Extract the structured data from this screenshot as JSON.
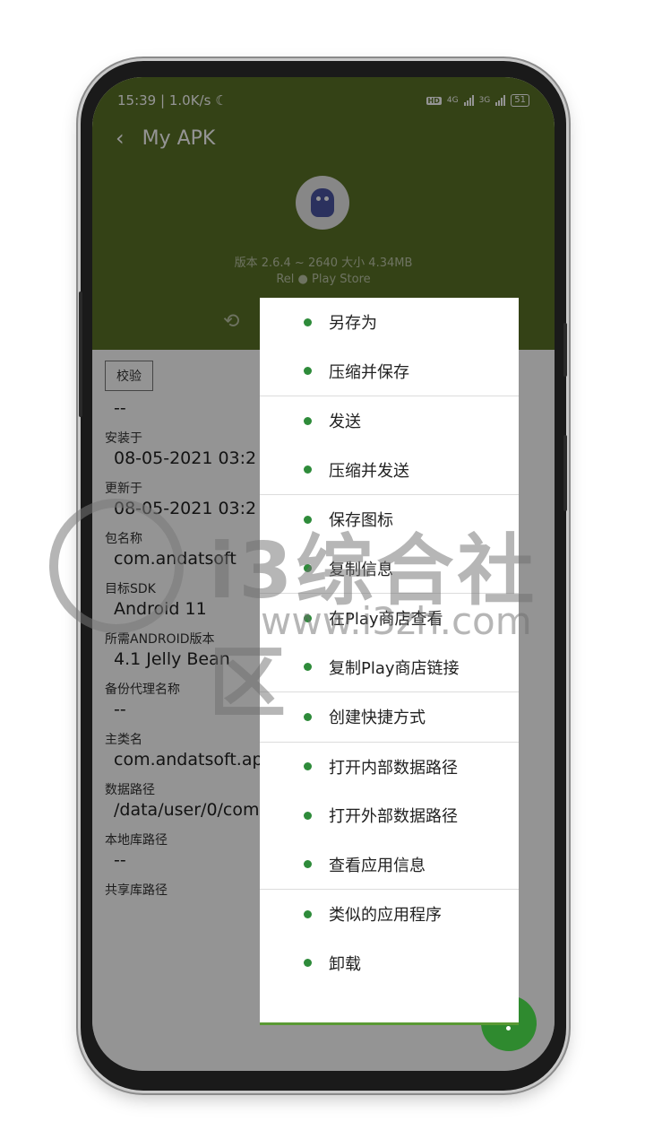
{
  "status_bar": {
    "time": "15:39",
    "speed": "1.0K/s",
    "hd": "HD",
    "net1": "4G",
    "net2": "3G",
    "battery": "51"
  },
  "toolbar": {
    "back_icon": "back-arrow-icon",
    "title": "My APK"
  },
  "app_info": {
    "version_line": "版本 2.6.4 ~ 2640 大小 4.34MB",
    "source_line": "Rel ● Play Store"
  },
  "detail": {
    "verify_chip": "校验",
    "verify_value": "--",
    "fields": [
      {
        "label": "安装于",
        "value": "08-05-2021 03:2"
      },
      {
        "label": "更新于",
        "value": "08-05-2021 03:2"
      },
      {
        "label": "包名称",
        "value": "com.andatsoft"
      },
      {
        "label": "目标SDK",
        "value": "Android 11"
      },
      {
        "label": "所需ANDROID版本",
        "value": "4.1 Jelly Bean"
      },
      {
        "label": "备份代理名称",
        "value": "--"
      },
      {
        "label": "主类名",
        "value": "com.andatsoft.ap"
      },
      {
        "label": "数据路径",
        "value": "/data/user/0/com"
      },
      {
        "label": "本地库路径",
        "value": "--"
      },
      {
        "label": "共享库路径",
        "value": ""
      }
    ]
  },
  "menu": {
    "groups": [
      [
        "另存为",
        "压缩并保存"
      ],
      [
        "发送",
        "压缩并发送"
      ],
      [
        "保存图标",
        "复制信息"
      ],
      [
        "在Play商店查看",
        "复制Play商店链接"
      ],
      [
        "创建快捷方式"
      ],
      [
        "打开内部数据路径",
        "打开外部数据路径",
        "查看应用信息"
      ],
      [
        "类似的应用程序",
        "卸载"
      ]
    ]
  },
  "watermark": {
    "text": "i3综合社区",
    "url": "www.i3zh.com"
  },
  "colors": {
    "header": "#5a7226",
    "accent": "#2e8b3a"
  }
}
